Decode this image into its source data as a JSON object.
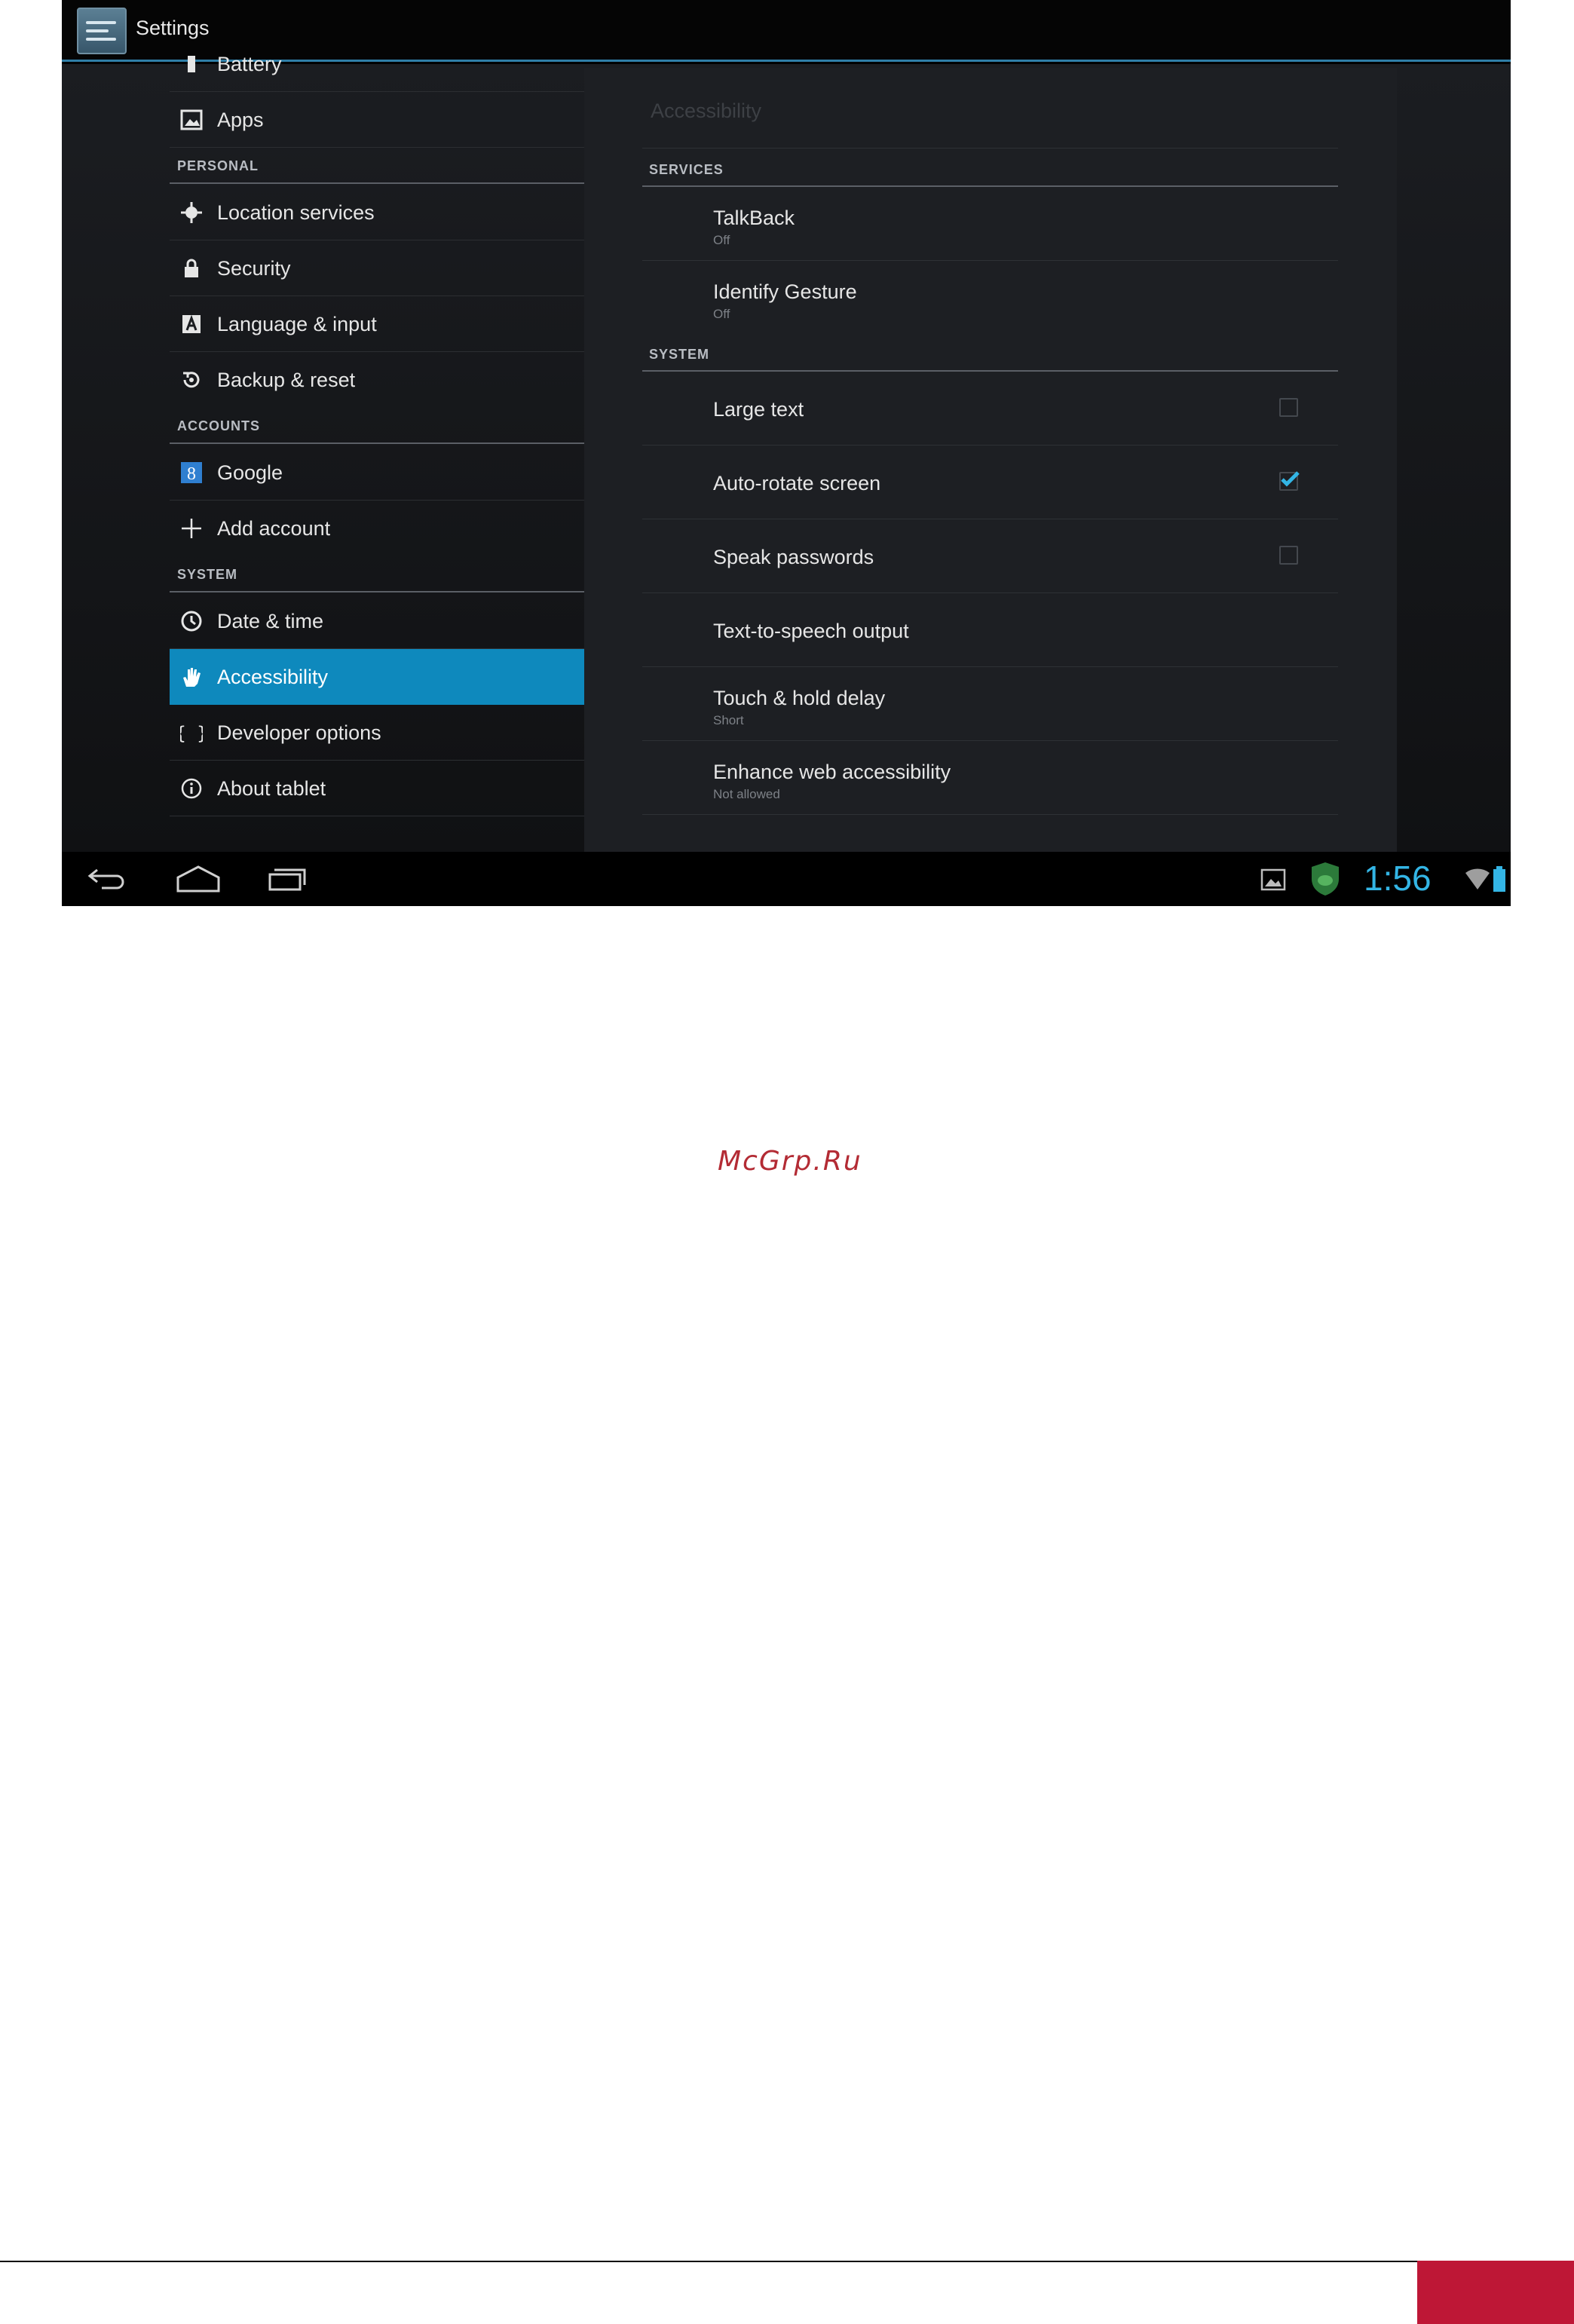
{
  "app": {
    "title": "Settings"
  },
  "sidebar": {
    "items_top": [
      {
        "label": "Battery",
        "icon": "battery-icon"
      },
      {
        "label": "Apps",
        "icon": "apps-icon"
      }
    ],
    "sections": [
      {
        "header": "PERSONAL",
        "items": [
          {
            "label": "Location services",
            "icon": "location-icon"
          },
          {
            "label": "Security",
            "icon": "lock-icon"
          },
          {
            "label": "Language & input",
            "icon": "language-icon"
          },
          {
            "label": "Backup & reset",
            "icon": "backup-icon"
          }
        ]
      },
      {
        "header": "ACCOUNTS",
        "items": [
          {
            "label": "Google",
            "icon": "google-icon"
          },
          {
            "label": "Add account",
            "icon": "plus-icon"
          }
        ]
      },
      {
        "header": "SYSTEM",
        "items": [
          {
            "label": "Date & time",
            "icon": "clock-icon"
          },
          {
            "label": "Accessibility",
            "icon": "hand-icon",
            "selected": true
          },
          {
            "label": "Developer options",
            "icon": "braces-icon"
          },
          {
            "label": "About tablet",
            "icon": "info-icon"
          }
        ]
      }
    ]
  },
  "panel": {
    "title": "Accessibility",
    "services_header": "SERVICES",
    "services": [
      {
        "title": "TalkBack",
        "summary": "Off"
      },
      {
        "title": "Identify Gesture",
        "summary": "Off"
      }
    ],
    "system_header": "SYSTEM",
    "system": [
      {
        "title": "Large text",
        "checkbox": false
      },
      {
        "title": "Auto-rotate screen",
        "checkbox": true
      },
      {
        "title": "Speak passwords",
        "checkbox": false
      },
      {
        "title": "Text-to-speech output"
      },
      {
        "title": "Touch & hold delay",
        "summary": "Short"
      },
      {
        "title": "Enhance web accessibility",
        "summary": "Not allowed"
      }
    ]
  },
  "navbar": {
    "clock": "1:56"
  },
  "page": {
    "watermark": "McGrp.Ru"
  },
  "colors": {
    "accent": "#33b5e5",
    "selected": "#0e89bd",
    "footer": "#be1736",
    "watermark": "#b32b34"
  }
}
